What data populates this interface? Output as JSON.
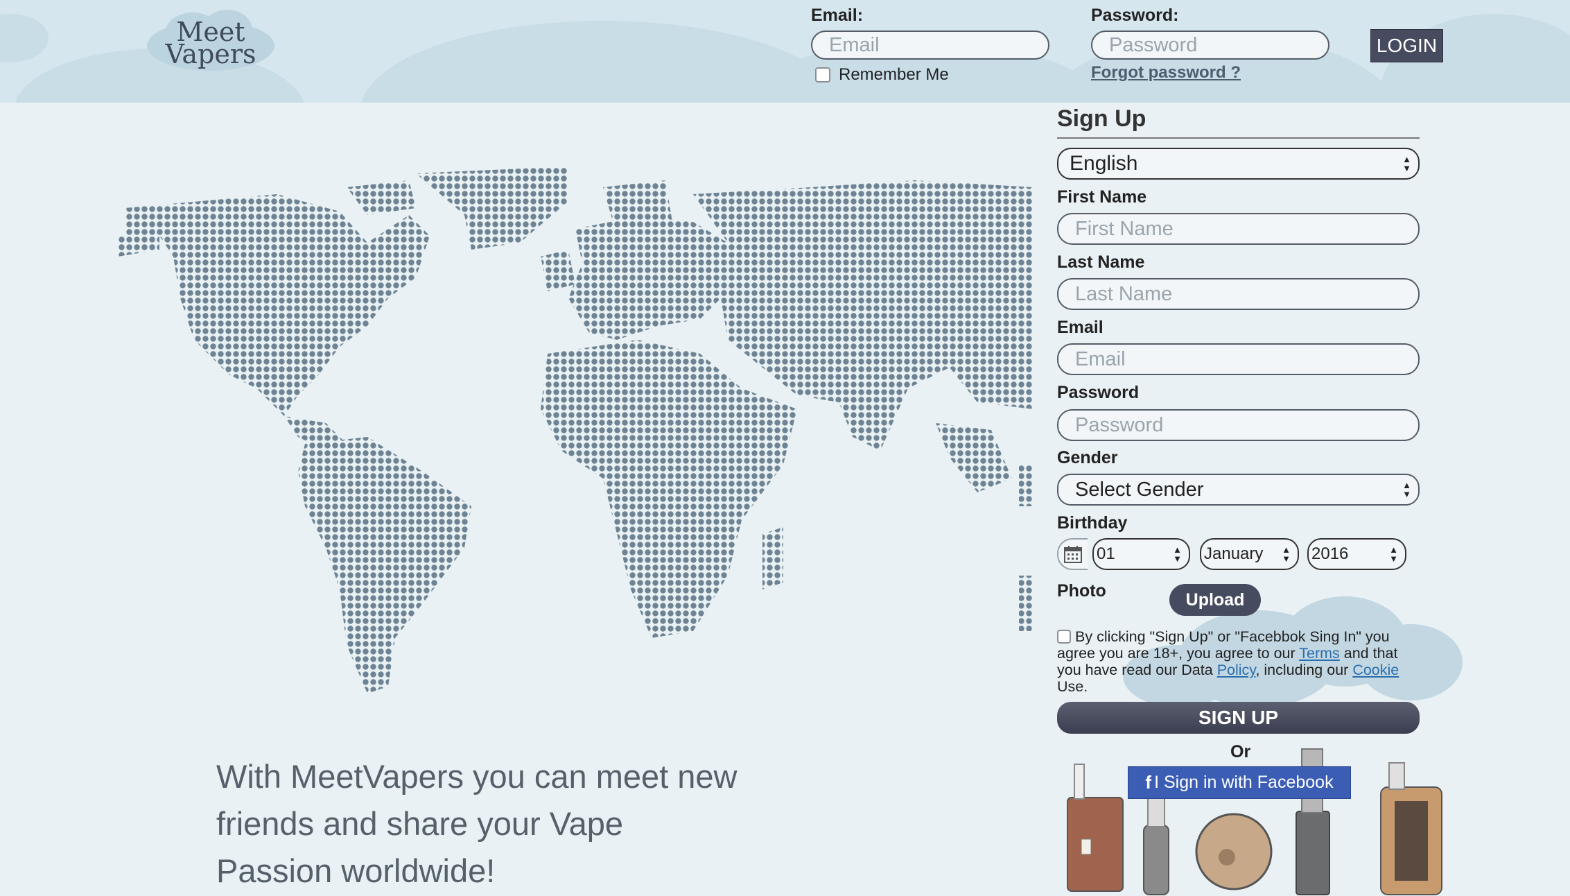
{
  "header": {
    "logo_line1": "Meet",
    "logo_line2": "Vapers",
    "email_label": "Email:",
    "email_placeholder": "Email",
    "password_label": "Password:",
    "password_placeholder": "Password",
    "remember_label": "Remember Me",
    "forgot_label": "Forgot password ?",
    "login_label": "LOGIN"
  },
  "tagline": "With MeetVapers you can meet new friends and share your Vape Passion worldwide!",
  "signup": {
    "title": "Sign Up",
    "language": "English",
    "first_name_label": "First Name",
    "first_name_placeholder": "First Name",
    "last_name_label": "Last Name",
    "last_name_placeholder": "Last Name",
    "email_label": "Email",
    "email_placeholder": "Email",
    "password_label": "Password",
    "password_placeholder": "Password",
    "gender_label": "Gender",
    "gender_value": "Select Gender",
    "birthday_label": "Birthday",
    "birthday_day": "01",
    "birthday_month": "January",
    "birthday_year": "2016",
    "photo_label": "Photo",
    "upload_label": "Upload",
    "terms_text_1": "By clicking \"Sign Up\" or \"Facebbok Sing In\" you agree you are 18+, you agree to our",
    "terms_link": "Terms",
    "terms_text_2": "and that you have read our Data",
    "policy_link": "Policy",
    "terms_text_3": ", including our",
    "cookie_link": "Cookie",
    "terms_text_4": "Use.",
    "signup_label": "SIGN UP",
    "or_label": "Or",
    "facebook_label": "I Sign in with Facebook"
  },
  "colors": {
    "header_bg": "#d6e6ee",
    "page_bg": "#e9f1f4",
    "button_dark": "#474b5f",
    "facebook_blue": "#3b5db4",
    "map_dot": "#6e8494"
  },
  "icons": [
    "calendar-icon",
    "facebook-icon",
    "select-arrows-icon"
  ]
}
